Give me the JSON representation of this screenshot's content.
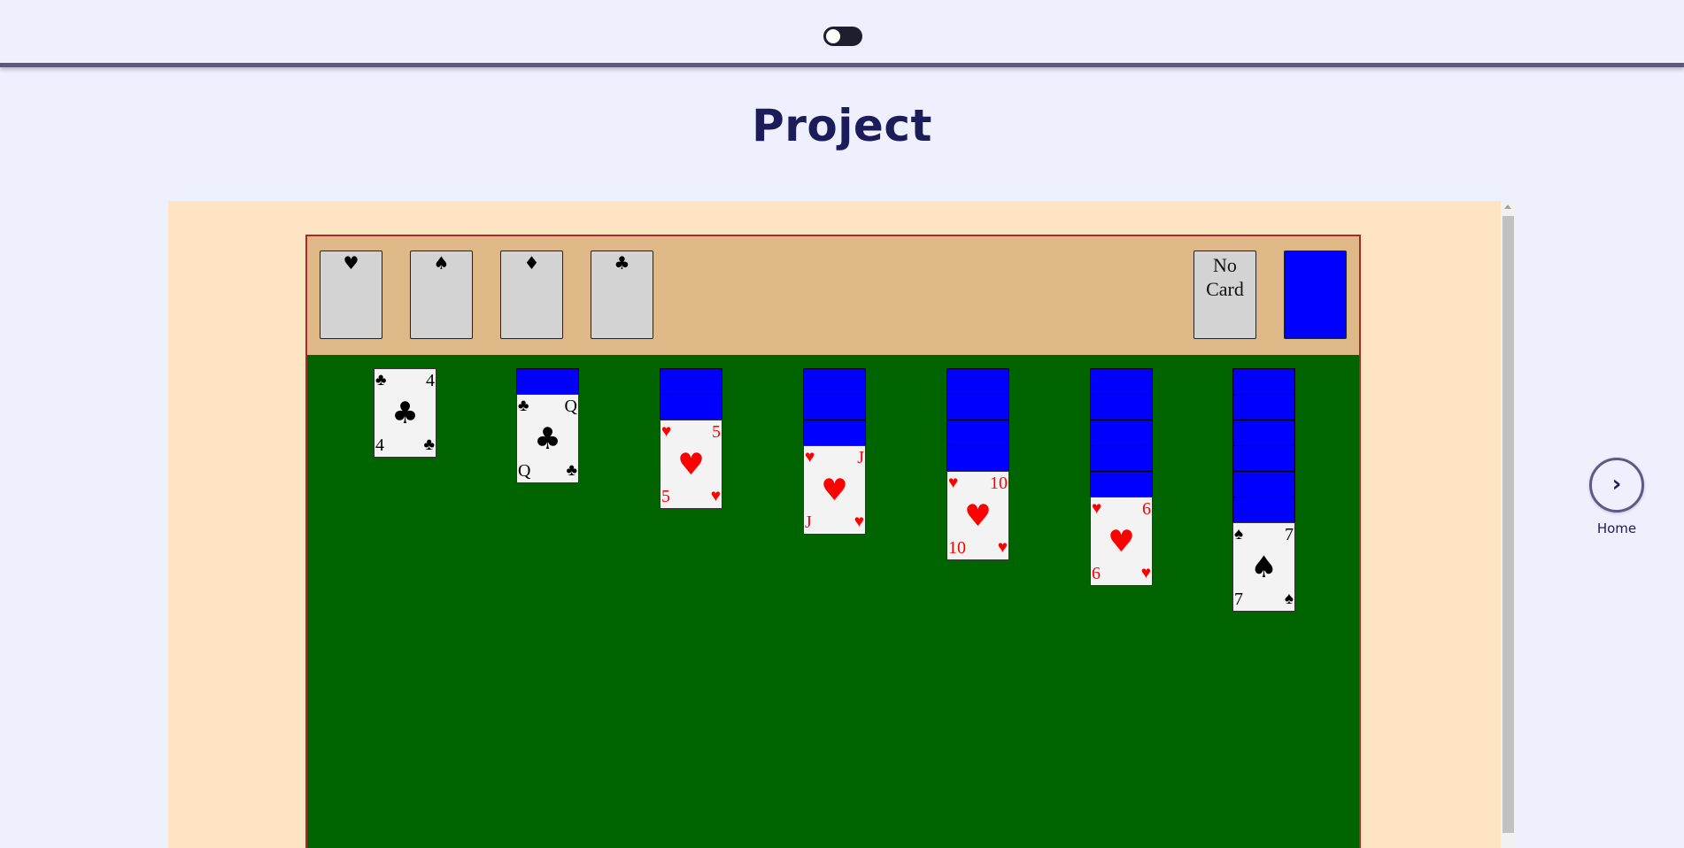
{
  "header": {
    "theme_toggle": "dark-mode-toggle"
  },
  "page": {
    "title": "Project"
  },
  "game": {
    "foundations": [
      {
        "suit": "♥"
      },
      {
        "suit": "♠"
      },
      {
        "suit": "♦"
      },
      {
        "suit": "♣"
      }
    ],
    "waste_label": "No Card",
    "stock_color": "#0000ff",
    "colors": {
      "felt": "#006400",
      "top_area": "#deb887",
      "frame": "#ffe4c4",
      "card_back": "#0000ff",
      "red_suit": "#ff0000",
      "title": "#1d1c5a"
    },
    "tableau": [
      {
        "face_down": 0,
        "card": {
          "rank": "4",
          "suit": "♣",
          "color": "black"
        }
      },
      {
        "face_down": 1,
        "card": {
          "rank": "Q",
          "suit": "♣",
          "color": "black"
        }
      },
      {
        "face_down": 2,
        "card": {
          "rank": "5",
          "suit": "♥",
          "color": "red"
        }
      },
      {
        "face_down": 3,
        "card": {
          "rank": "J",
          "suit": "♥",
          "color": "red"
        }
      },
      {
        "face_down": 4,
        "card": {
          "rank": "10",
          "suit": "♥",
          "color": "red"
        }
      },
      {
        "face_down": 5,
        "card": {
          "rank": "6",
          "suit": "♥",
          "color": "red"
        }
      },
      {
        "face_down": 6,
        "card": {
          "rank": "7",
          "suit": "♠",
          "color": "black"
        }
      }
    ]
  },
  "nav": {
    "next_icon": "›",
    "next_label": "Home"
  }
}
